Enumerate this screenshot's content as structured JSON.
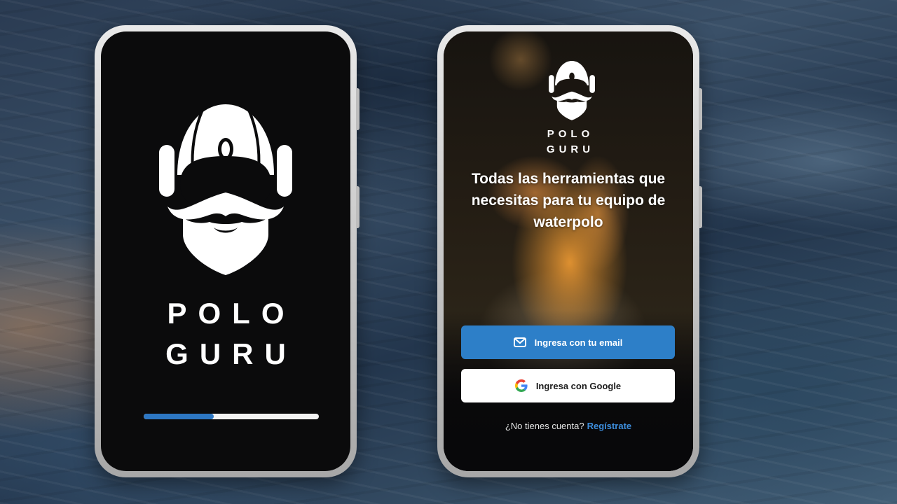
{
  "splash": {
    "brand_line1": "POLO",
    "brand_line2": "GURU",
    "progress": 0.4
  },
  "login": {
    "brand_line1": "POLO",
    "brand_line2": "GURU",
    "tagline": "Todas las herramientas que necesitas para tu equipo de waterpolo",
    "email_button_label": "Ingresa con tu email",
    "google_button_label": "Ingresa con Google",
    "signup_prompt": "¿No tienes cuenta?",
    "signup_link": "Regístrate"
  },
  "colors": {
    "accent_blue": "#2d7fc8",
    "progress_blue": "#2d77c3",
    "link_blue": "#3d8ddc"
  },
  "icons": {
    "email": "mail-icon",
    "google": "google-g-icon",
    "logo": "polo-guru-logo"
  }
}
